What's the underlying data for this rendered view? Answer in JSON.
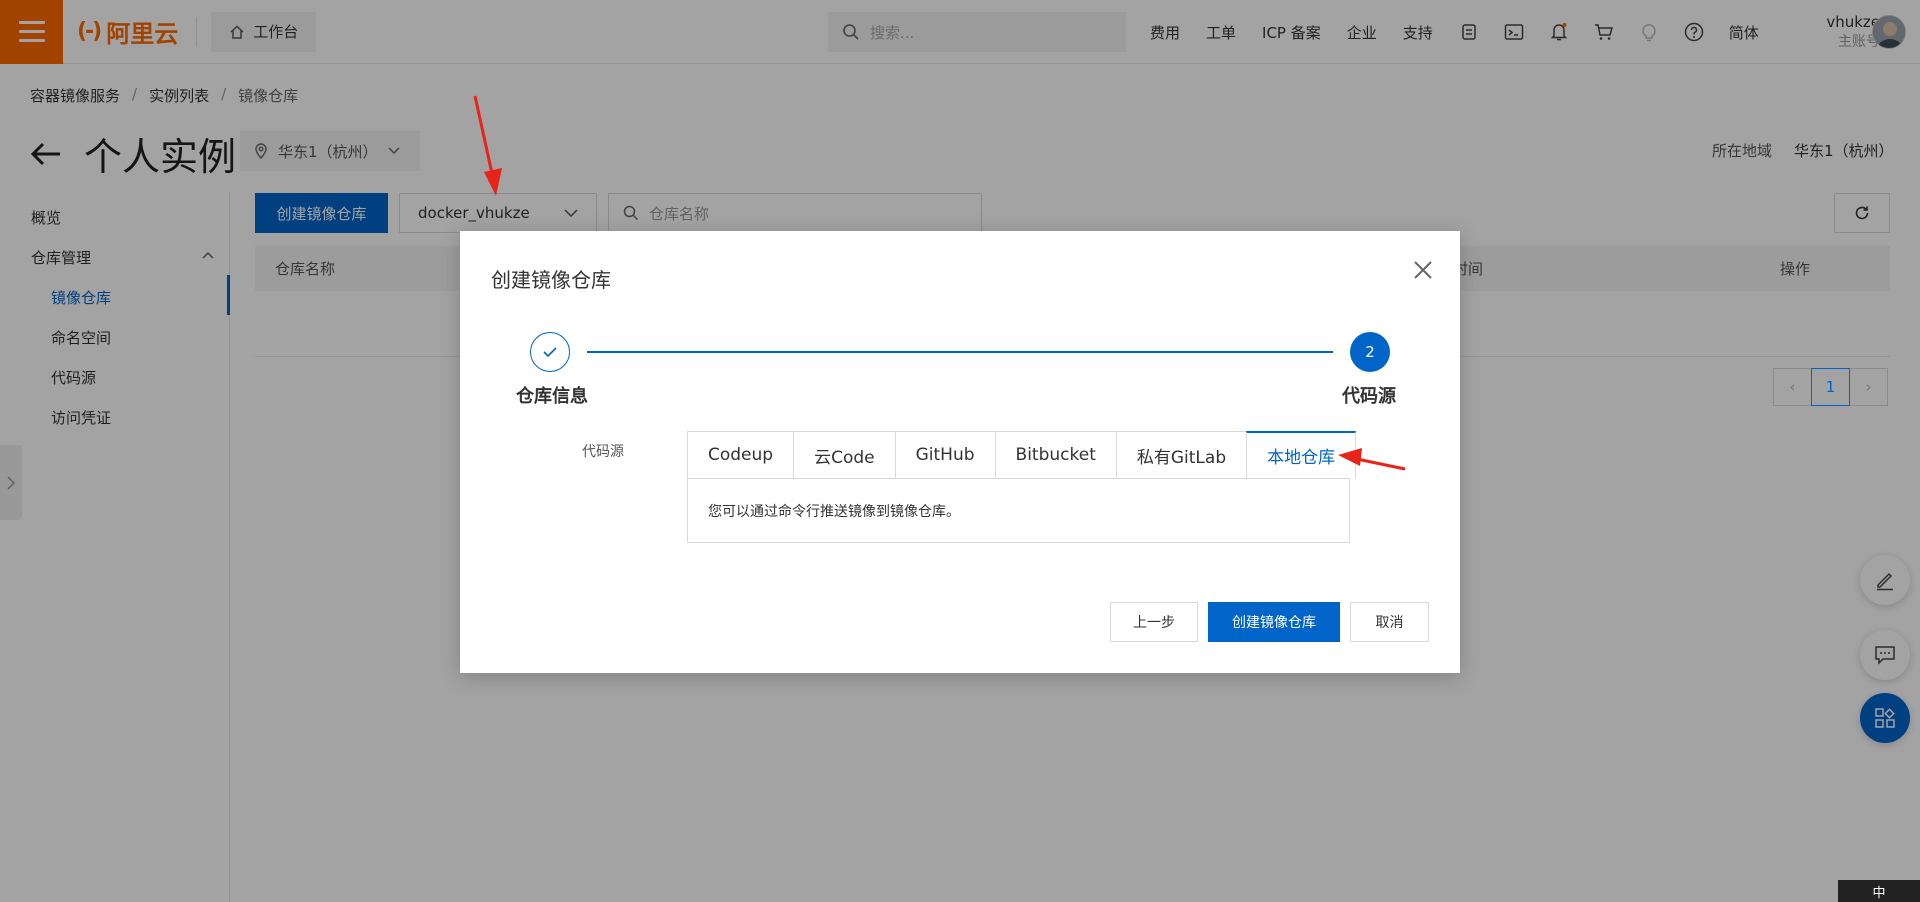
{
  "topbar": {
    "logo": "阿里云",
    "workbench": "工作台",
    "search_placeholder": "搜索...",
    "nav": [
      "费用",
      "工单",
      "ICP 备案",
      "企业",
      "支持"
    ],
    "lang": "简体",
    "username": "vhukze",
    "account_type": "主账号"
  },
  "breadcrumb": [
    "容器镜像服务",
    "实例列表",
    "镜像仓库"
  ],
  "page": {
    "title": "个人实例",
    "region_select": "华东1（杭州）",
    "region_label": "所在地域",
    "region_value": "华东1（杭州）"
  },
  "sidebar": {
    "overview": "概览",
    "repo_mgmt": "仓库管理",
    "items": [
      "镜像仓库",
      "命名空间",
      "代码源",
      "访问凭证"
    ]
  },
  "toolbar": {
    "create_button": "创建镜像仓库",
    "namespace": "docker_vhukze",
    "search_placeholder": "仓库名称"
  },
  "table": {
    "col_name": "仓库名称",
    "col_time": "时间",
    "col_action": "操作"
  },
  "pagination": {
    "current": "1"
  },
  "modal": {
    "title": "创建镜像仓库",
    "step1_label": "仓库信息",
    "step2_number": "2",
    "step2_label": "代码源",
    "source_label": "代码源",
    "tabs": [
      "Codeup",
      "云Code",
      "GitHub",
      "Bitbucket",
      "私有GitLab",
      "本地仓库"
    ],
    "active_tab": "本地仓库",
    "panel_text": "您可以通过命令行推送镜像到镜像仓库。",
    "prev_button": "上一步",
    "create_button": "创建镜像仓库",
    "cancel_button": "取消"
  },
  "ime": "中",
  "colors": {
    "brand": "#ff6a00",
    "primary": "#0064c8",
    "annotation": "#e8231a"
  }
}
